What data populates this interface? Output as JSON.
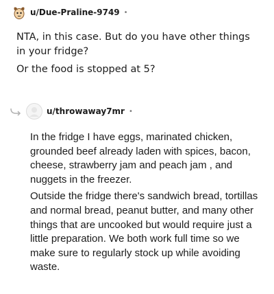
{
  "comment": {
    "username": "u/Due-Praline-9749",
    "separator": "•",
    "avatar_icon": "snoo-avatar-icon",
    "paragraphs": [
      "NTA, in this case. But do you have other things in your fridge?",
      "Or the food is stopped at 5?"
    ]
  },
  "reply": {
    "username": "u/throwaway7mr",
    "separator": "•",
    "reply_icon": "reply-arrow-icon",
    "avatar_icon": "default-avatar-icon",
    "paragraphs": [
      "In the fridge I have eggs, marinated chicken, grounded beef already laden with spices, bacon, cheese, strawberry jam and peach jam , and nuggets in the freezer.",
      "Outside the fridge there's sandwich bread, tortillas and normal bread, peanut butter, and many other things that are uncooked but would require just a little preparation. We both work full time so we make sure to regularly stock up while avoiding waste."
    ]
  }
}
